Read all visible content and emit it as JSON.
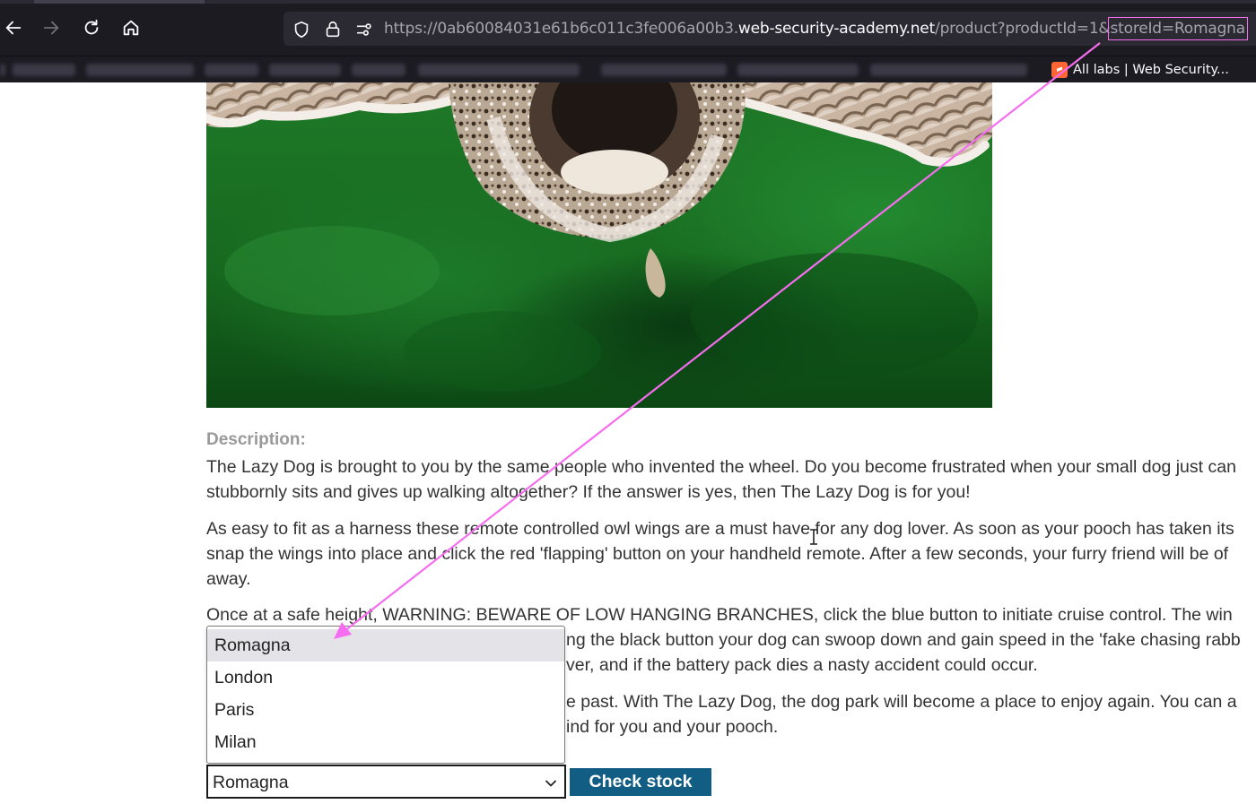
{
  "browser": {
    "url_prefix": "https://0ab60084031e61b6c011c3fe006a00b3.",
    "url_domain": "web-security-academy.net",
    "url_path": "/product?productId=1&",
    "url_param_highlight": "storeId=Romagna",
    "bookmark_label": "All labs | Web Security..."
  },
  "product": {
    "description_heading": "Description:",
    "paragraphs": [
      "The Lazy Dog is brought to you by the same people who invented the wheel. Do you become frustrated when your small dog just can",
      "stubbornly sits and gives up walking altogether? If the answer is yes, then The Lazy Dog is for you!",
      "As easy to fit as a harness these remote controlled owl wings are a must have for any dog lover. As soon as your pooch has taken its",
      "snap the wings into place and click the red 'flapping' button on your handheld remote. After a few seconds, your furry friend will be of",
      "away.",
      "Once at a safe height, WARNING: BEWARE OF LOW HANGING BRANCHES, click the blue button to initiate cruise control. The win",
      "ng the black button your dog can swoop down and gain speed in the 'fake chasing rabb",
      "ver, and if the battery pack dies a nasty accident could occur.",
      "e past. With The Lazy Dog, the dog park will become a place to enjoy again. You can a",
      "ind for you and your pooch."
    ]
  },
  "stock": {
    "options": [
      "Romagna",
      "London",
      "Paris",
      "Milan"
    ],
    "selected_value": "Romagna",
    "button_label": "Check stock"
  },
  "colors": {
    "annotation": "#f66df0",
    "button": "#115d84"
  }
}
